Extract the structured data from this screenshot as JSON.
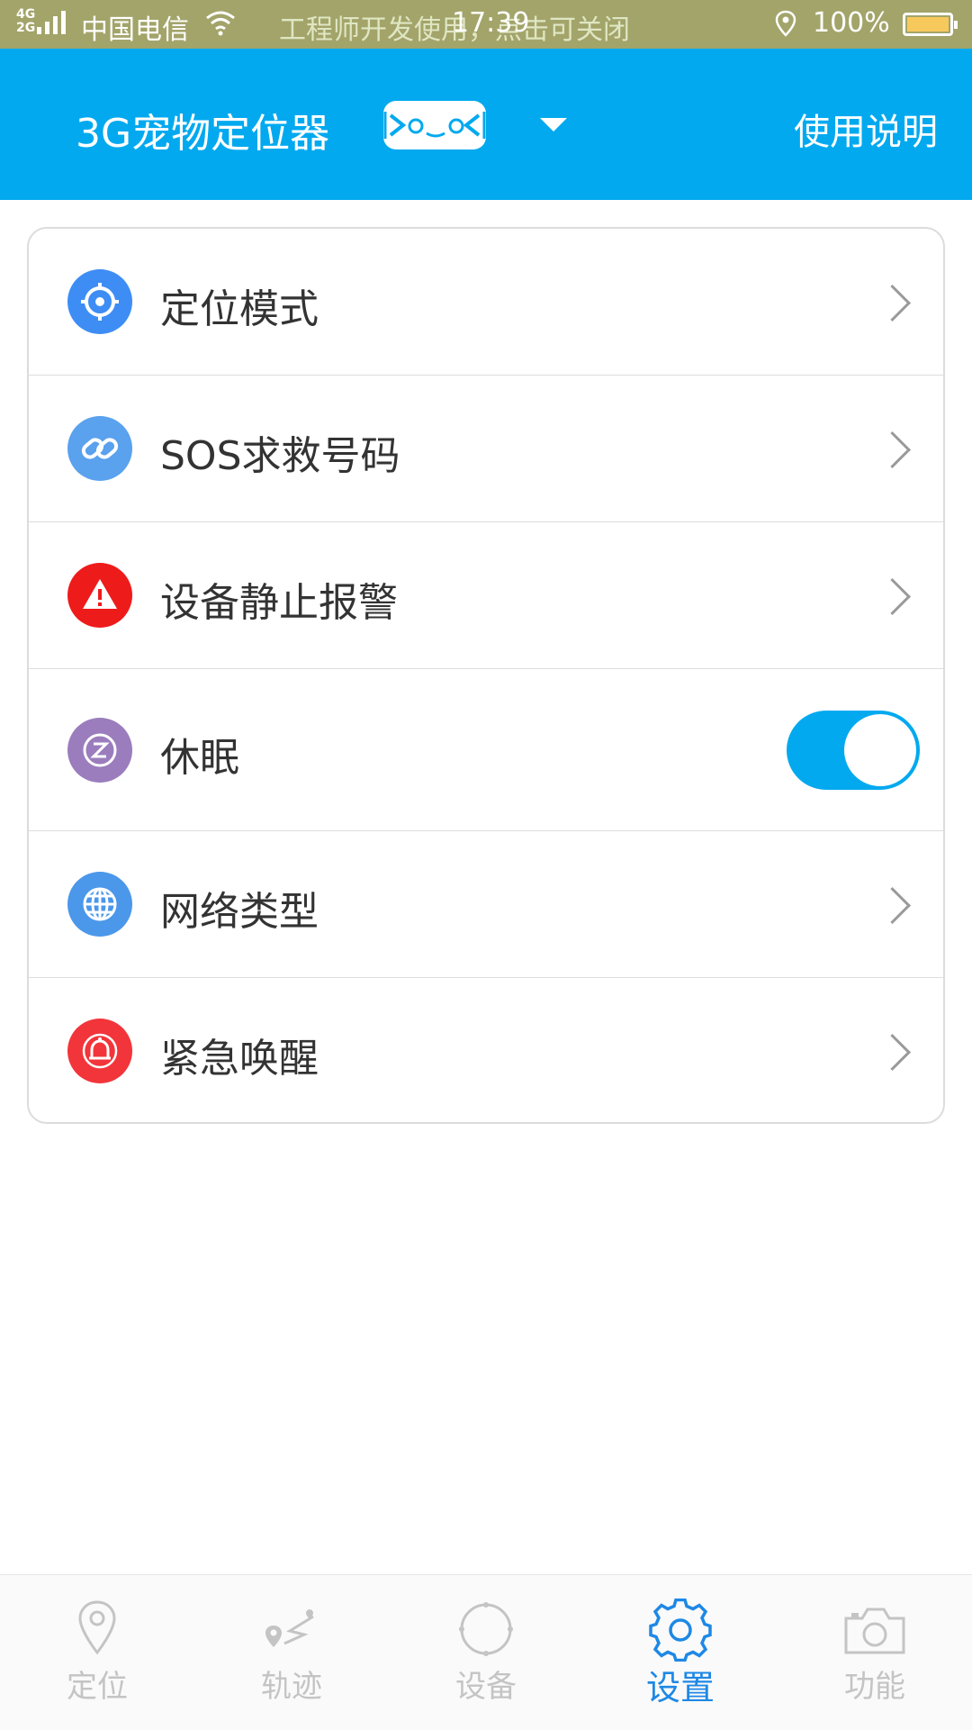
{
  "status_bar": {
    "network": "4G 2G",
    "carrier": "中国电信",
    "notice": "工程师开发使用，点击可关闭",
    "time": "17:39",
    "battery": "100%"
  },
  "header": {
    "title": "3G宠物定位器",
    "help_label": "使用说明",
    "background_color": "#02a9ef"
  },
  "settings": {
    "items": [
      {
        "label": "定位模式",
        "icon": "crosshair-icon",
        "color": "#3d8df5",
        "control": "chevron"
      },
      {
        "label": "SOS求救号码",
        "icon": "link-icon",
        "color": "#5aa1ee",
        "control": "chevron"
      },
      {
        "label": "设备静止报警",
        "icon": "warning-icon",
        "color": "#ee1b1b",
        "control": "chevron"
      },
      {
        "label": "休眠",
        "icon": "sleep-icon",
        "color": "#9b7dbd",
        "control": "toggle",
        "toggle_on": true
      },
      {
        "label": "网络类型",
        "icon": "globe-icon",
        "color": "#4b97ea",
        "control": "chevron"
      },
      {
        "label": "紧急唤醒",
        "icon": "bell-icon",
        "color": "#f2353a",
        "control": "chevron"
      }
    ]
  },
  "bottom_nav": {
    "active_index": 3,
    "active_color": "#1e88e5",
    "tabs": [
      {
        "label": "定位",
        "icon": "location-pin-icon"
      },
      {
        "label": "轨迹",
        "icon": "track-icon"
      },
      {
        "label": "设备",
        "icon": "device-icon"
      },
      {
        "label": "设置",
        "icon": "settings-gear-icon"
      },
      {
        "label": "功能",
        "icon": "camera-icon"
      }
    ]
  }
}
